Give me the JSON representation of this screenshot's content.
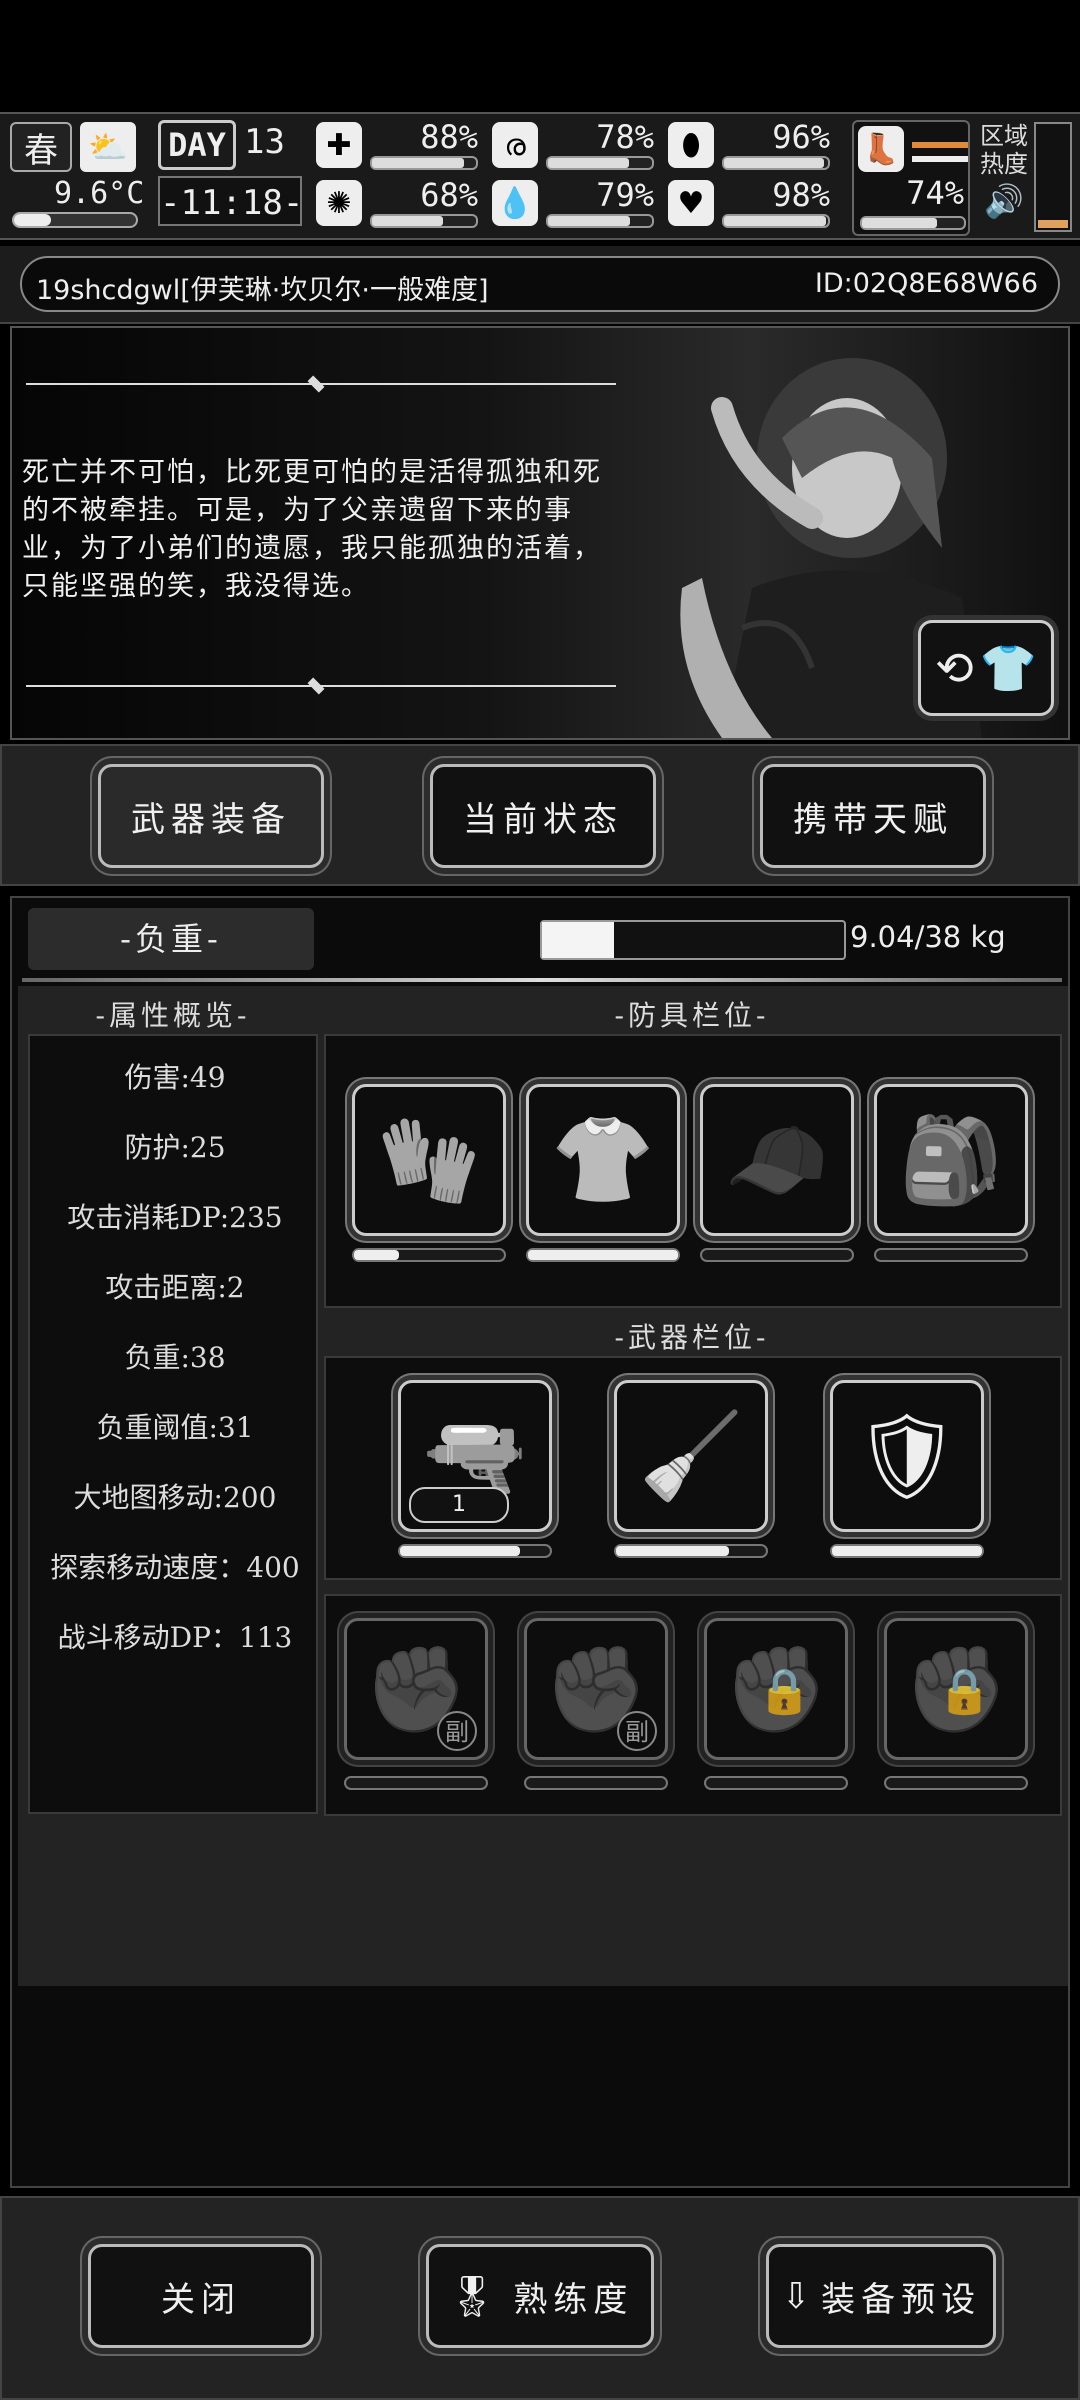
{
  "status": {
    "season": "春",
    "day_label": "DAY",
    "day_number": "13",
    "temperature": "9.6°C",
    "clock": "-11:18-",
    "stats": [
      {
        "name": "health",
        "icon": "medkit-icon",
        "percent": "88%",
        "value": 0.88
      },
      {
        "name": "hunger",
        "icon": "stomach-icon",
        "percent": "78%",
        "value": 0.78
      },
      {
        "name": "fatigue",
        "icon": "capsule-icon",
        "percent": "96%",
        "value": 0.96
      },
      {
        "name": "mental",
        "icon": "brain-icon",
        "percent": "68%",
        "value": 0.68
      },
      {
        "name": "thirst",
        "icon": "water-drop-icon",
        "percent": "79%",
        "value": 0.79
      },
      {
        "name": "mood",
        "icon": "heart-icon",
        "percent": "98%",
        "value": 0.98
      }
    ],
    "foot_percent": "74%",
    "foot_value": 0.74,
    "region_heat_label_1": "区域",
    "region_heat_label_2": "热度"
  },
  "player": {
    "name_line": "19shcdgwl[伊芙琳·坎贝尔·一般难度]",
    "id_line": "ID:02Q8E68W66"
  },
  "story": {
    "quote": "死亡并不可怕，比死更可怕的是活得孤独和死的不被牵挂。可是，为了父亲遗留下来的事业，为了小弟们的遗愿，我只能孤独的活着，只能坚强的笑，我没得选。"
  },
  "tabs": [
    {
      "label": "武器装备",
      "active": true
    },
    {
      "label": "当前状态",
      "active": false
    },
    {
      "label": "携带天赋",
      "active": false
    }
  ],
  "weight": {
    "label": "-负重-",
    "value_text": "9.04/38 kg",
    "fraction": 0.24
  },
  "attributes": {
    "title": "-属性概览-",
    "items": [
      "伤害:49",
      "防护:25",
      "攻击消耗DP:235",
      "攻击距离:2",
      "负重:38",
      "负重阈值:31",
      "大地图移动:200",
      "探索移动速度：400",
      "战斗移动DP：113"
    ]
  },
  "armor": {
    "title": "-防具栏位-",
    "slots": [
      {
        "name": "gloves-icon",
        "durability": 0.3,
        "dim": false
      },
      {
        "name": "clothing-icon",
        "durability": 1.0,
        "dim": false
      },
      {
        "name": "visor-cap-icon",
        "durability": 0,
        "dim": true
      },
      {
        "name": "backpack-icon",
        "durability": 0,
        "dim": false
      }
    ]
  },
  "weapons": {
    "title": "-武器栏位-",
    "slots": [
      {
        "name": "nail-gun-icon",
        "badge": "1",
        "durability": 0.8
      },
      {
        "name": "shovel-icon",
        "durability": 0.75
      },
      {
        "name": "riot-shield-icon",
        "durability": 1.0
      }
    ]
  },
  "sub_slots": [
    {
      "name": "fist-icon",
      "tag": "副",
      "locked": false
    },
    {
      "name": "fist-icon",
      "tag": "副",
      "locked": false
    },
    {
      "name": "fist-icon",
      "tag": "",
      "locked": true
    },
    {
      "name": "fist-icon",
      "tag": "",
      "locked": true
    }
  ],
  "footer": {
    "close_label": "关闭",
    "proficiency_label": "熟练度",
    "preset_label": "装备预设"
  }
}
